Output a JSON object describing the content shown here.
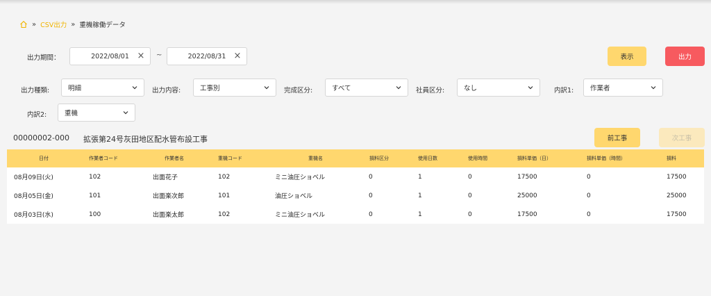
{
  "breadcrumb": {
    "home_icon": "home-icon",
    "link": "CSV出力",
    "current": "重機稼働データ",
    "separator": "»"
  },
  "filters": {
    "period_label": "出力期間：",
    "date_from": "2022/08/01",
    "date_to": "2022/08/31",
    "tilde": "~",
    "clear_icon": "×",
    "type_label": "出力種類:",
    "type_value": "明細",
    "content_label": "出力内容:",
    "content_value": "工事別",
    "completion_label": "完成区分:",
    "completion_value": "すべて",
    "employee_label": "社員区分:",
    "employee_value": "なし",
    "breakdown1_label": "内訳1:",
    "breakdown1_value": "作業者",
    "breakdown2_label": "内訳2:",
    "breakdown2_value": "重機"
  },
  "buttons": {
    "display": "表示",
    "export": "出力",
    "prev_project": "前工事",
    "next_project": "次工事"
  },
  "project": {
    "id": "00000002-000",
    "name": "拡張第24号灰田地区配水管布設工事"
  },
  "table": {
    "headers": [
      "日付",
      "作業者コード",
      "作業者名",
      "重機コード",
      "重機名",
      "損料区分",
      "使用日数",
      "使用時間",
      "損料単価（日）",
      "損料単価（時間）",
      "損料"
    ],
    "rows": [
      [
        "08月09日(火)",
        "102",
        "出面花子",
        "102",
        "ミニ油圧ショベル",
        "0",
        "1",
        "0",
        "17500",
        "0",
        "17500"
      ],
      [
        "08月05日(金)",
        "101",
        "出面楽次郎",
        "101",
        "油圧ショベル",
        "0",
        "1",
        "0",
        "25000",
        "0",
        "25000"
      ],
      [
        "08月03日(水)",
        "100",
        "出面楽太郎",
        "102",
        "ミニ油圧ショベル",
        "0",
        "1",
        "0",
        "17500",
        "0",
        "17500"
      ]
    ]
  },
  "colors": {
    "accent_yellow": "#ffd76e",
    "danger_red": "#f75a5f",
    "link_yellow": "#f0b400"
  }
}
